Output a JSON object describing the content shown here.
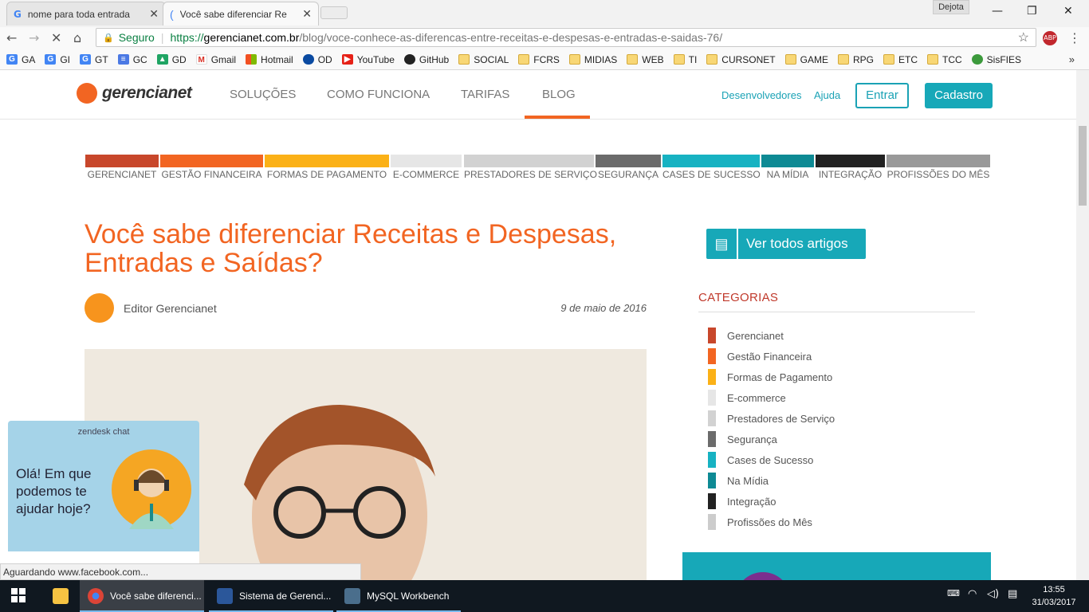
{
  "browser": {
    "tabs": [
      {
        "title": "nome para toda entrada",
        "icon": "google-icon"
      },
      {
        "title": "Você sabe diferenciar Re",
        "icon": "loading-icon"
      }
    ],
    "user_label": "Dejota",
    "address": {
      "secure_label": "Seguro",
      "protocol": "https://",
      "host": "gerencianet.com.br",
      "path": "/blog/voce-conhece-as-diferencas-entre-receitas-e-despesas-e-entradas-e-saidas-76/"
    },
    "bookmarks": [
      {
        "label": "GA",
        "icon": "google-icon"
      },
      {
        "label": "GI",
        "icon": "google-icon"
      },
      {
        "label": "GT",
        "icon": "translate-icon"
      },
      {
        "label": "GC",
        "icon": "docs-icon"
      },
      {
        "label": "GD",
        "icon": "drive-icon"
      },
      {
        "label": "Gmail",
        "icon": "gmail-icon"
      },
      {
        "label": "Hotmail",
        "icon": "windows-icon"
      },
      {
        "label": "OD",
        "icon": "onedrive-icon"
      },
      {
        "label": "YouTube",
        "icon": "youtube-icon"
      },
      {
        "label": "GitHub",
        "icon": "github-icon"
      },
      {
        "label": "SOCIAL",
        "icon": "folder-icon"
      },
      {
        "label": "FCRS",
        "icon": "folder-icon"
      },
      {
        "label": "MIDIAS",
        "icon": "folder-icon"
      },
      {
        "label": "WEB",
        "icon": "folder-icon"
      },
      {
        "label": "TI",
        "icon": "folder-icon"
      },
      {
        "label": "CURSONET",
        "icon": "folder-icon"
      },
      {
        "label": "GAME",
        "icon": "folder-icon"
      },
      {
        "label": "RPG",
        "icon": "folder-icon"
      },
      {
        "label": "ETC",
        "icon": "folder-icon"
      },
      {
        "label": "TCC",
        "icon": "folder-icon"
      },
      {
        "label": "SisFIES",
        "icon": "globe-icon"
      }
    ],
    "more": "»",
    "status_text": "Aguardando www.facebook.com..."
  },
  "site": {
    "logo": "gerencianet",
    "menu": [
      "SOLUÇÕES",
      "COMO FUNCIONA",
      "TARIFAS",
      "BLOG"
    ],
    "links": {
      "dev": "Desenvolvedores",
      "help": "Ajuda"
    },
    "login": "Entrar",
    "signup": "Cadastro",
    "categories_bar": [
      {
        "label": "GERENCIANET",
        "color": "#c8472b"
      },
      {
        "label": "GESTÃO FINANCEIRA",
        "color": "#f26522"
      },
      {
        "label": "FORMAS DE PAGAMENTO",
        "color": "#fbb117"
      },
      {
        "label": "E-COMMERCE",
        "color": "#e6e6e6"
      },
      {
        "label": "PRESTADORES DE SERVIÇO",
        "color": "#d2d2d2"
      },
      {
        "label": "SEGURANÇA",
        "color": "#6b6b6b"
      },
      {
        "label": "CASES DE SUCESSO",
        "color": "#17b2c2"
      },
      {
        "label": "NA MÍDIA",
        "color": "#0e8a94"
      },
      {
        "label": "INTEGRAÇÃO",
        "color": "#222222"
      },
      {
        "label": "PROFISSÕES DO MÊS",
        "color": "#999999"
      }
    ],
    "article": {
      "title": "Você sabe diferenciar Receitas e Despesas, Entradas e Saídas?",
      "author": "Editor Gerencianet",
      "date": "9 de maio de 2016"
    },
    "sidebar": {
      "see_all": "Ver todos artigos",
      "categories_title": "CATEGORIAS",
      "categories": [
        {
          "label": "Gerencianet",
          "color": "#c8472b"
        },
        {
          "label": "Gestão Financeira",
          "color": "#f26522"
        },
        {
          "label": "Formas de Pagamento",
          "color": "#fbb117"
        },
        {
          "label": "E-commerce",
          "color": "#e6e6e6"
        },
        {
          "label": "Prestadores de Serviço",
          "color": "#d2d2d2"
        },
        {
          "label": "Segurança",
          "color": "#6b6b6b"
        },
        {
          "label": "Cases de Sucesso",
          "color": "#17b2c2"
        },
        {
          "label": "Na Mídia",
          "color": "#0e8a94"
        },
        {
          "label": "Integração",
          "color": "#222222"
        },
        {
          "label": "Profissões do Mês",
          "color": "#cccccc"
        }
      ]
    },
    "chat": {
      "header": "zendesk chat",
      "message": "Olá! Em que podemos te ajudar hoje?"
    }
  },
  "taskbar": {
    "items": [
      {
        "label": "Você sabe diferenci...",
        "icon": "chrome-icon"
      },
      {
        "label": "Sistema de Gerenci...",
        "icon": "word-icon"
      },
      {
        "label": "MySQL Workbench",
        "icon": "mysql-icon"
      }
    ],
    "time": "13:55",
    "date": "31/03/2017"
  }
}
